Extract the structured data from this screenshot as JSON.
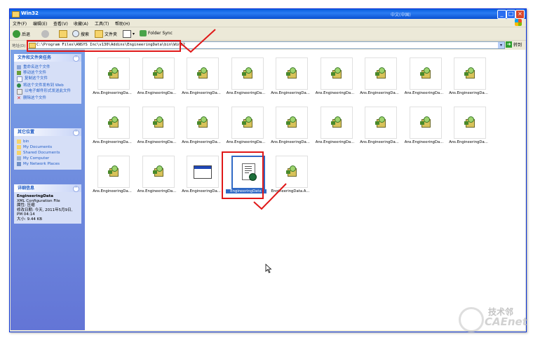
{
  "window": {
    "title": "Win32",
    "ime_label": "中文(中国)",
    "controls": {
      "minimize": "_",
      "maximize": "□",
      "close": "×"
    }
  },
  "menubar": [
    "文件(F)",
    "编辑(E)",
    "查看(V)",
    "收藏(A)",
    "工具(T)",
    "帮助(H)"
  ],
  "toolbar": {
    "back": "后退",
    "search": "搜索",
    "folders": "文件夹",
    "folder_sync": "Folder Sync"
  },
  "address": {
    "label": "地址(D)",
    "value": "C:\\Program Files\\ANSYS Inc\\v130\\Addins\\EngineeringData\\bin\\Win32",
    "go": "转到"
  },
  "tasks_panel": {
    "title": "文件和文件夹任务",
    "items": [
      {
        "label": "重命名这个文件",
        "icon": "rename-icon"
      },
      {
        "label": "移动这个文件",
        "icon": "move-icon"
      },
      {
        "label": "复制这个文件",
        "icon": "copy-icon"
      },
      {
        "label": "将这个文件发布到 Web",
        "icon": "web-publish-icon"
      },
      {
        "label": "以电子邮件形式发送此文件",
        "icon": "email-icon"
      },
      {
        "label": "删除这个文件",
        "icon": "delete-icon"
      }
    ]
  },
  "places_panel": {
    "title": "其它位置",
    "items": [
      {
        "label": "bin",
        "icon": "folder-icon"
      },
      {
        "label": "My Documents",
        "icon": "my-documents-icon"
      },
      {
        "label": "Shared Documents",
        "icon": "folder-icon"
      },
      {
        "label": "My Computer",
        "icon": "my-computer-icon"
      },
      {
        "label": "My Network Places",
        "icon": "network-places-icon"
      }
    ]
  },
  "details_panel": {
    "title": "详细信息",
    "name": "EngineeringData",
    "type": "XML Configuration File",
    "attributes": "属性: 压缩",
    "modified": "修改日期: 今天, 2011年5月9日, PM 04:14",
    "size": "大小: 9.44 KB"
  },
  "files": [
    {
      "label": "Ans.EngineeringDa...",
      "icon": "dll-setup-icon"
    },
    {
      "label": "Ans.EngineeringDa...",
      "icon": "dll-setup-icon"
    },
    {
      "label": "Ans.EngineeringDa...",
      "icon": "dll-setup-icon"
    },
    {
      "label": "Ans.EngineeringDa...",
      "icon": "dll-setup-icon"
    },
    {
      "label": "Ans.EngineeringDa...",
      "icon": "dll-setup-icon"
    },
    {
      "label": "Ans.EngineeringDa...",
      "icon": "dll-setup-icon"
    },
    {
      "label": "Ans.EngineeringDa...",
      "icon": "dll-setup-icon"
    },
    {
      "label": "Ans.EngineeringDa...",
      "icon": "dll-setup-icon"
    },
    {
      "label": "Ans.EngineeringDa...",
      "icon": "dll-setup-icon"
    },
    {
      "label": "Ans.EngineeringDa...",
      "icon": "dll-setup-icon"
    },
    {
      "label": "Ans.EngineeringDa...",
      "icon": "dll-setup-icon"
    },
    {
      "label": "Ans.EngineeringDa...",
      "icon": "dll-setup-icon"
    },
    {
      "label": "Ans.EngineeringDa...",
      "icon": "dll-setup-icon"
    },
    {
      "label": "Ans.EngineeringDa...",
      "icon": "dll-setup-icon"
    },
    {
      "label": "Ans.EngineeringDa...",
      "icon": "dll-setup-icon"
    },
    {
      "label": "Ans.EngineeringDa...",
      "icon": "dll-setup-icon"
    },
    {
      "label": "Ans.EngineeringDa...",
      "icon": "dll-setup-icon"
    },
    {
      "label": "Ans.EngineeringDa...",
      "icon": "dll-setup-icon"
    },
    {
      "label": "Ans.EngineeringDa...",
      "icon": "dll-setup-icon"
    },
    {
      "label": "Ans.EngineeringDa...",
      "icon": "dll-setup-icon"
    },
    {
      "label": "Ans.EngineeringDa...",
      "icon": "application-window-icon"
    },
    {
      "label": "EngineeringData",
      "icon": "xml-document-icon",
      "selected": true
    },
    {
      "label": "EngineeringData.A...",
      "icon": "dll-setup-icon"
    }
  ],
  "watermark": {
    "line1": "技术邻",
    "line2": "CAEnet"
  },
  "colors": {
    "selection": "#316ac5",
    "annotation": "#e01818",
    "titlebar": "#0a5fdf"
  }
}
